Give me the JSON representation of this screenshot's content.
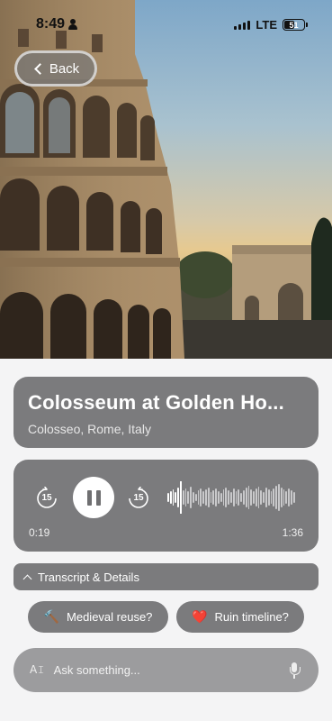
{
  "status_bar": {
    "time": "8:49",
    "network": "LTE",
    "battery": "51"
  },
  "nav": {
    "back_label": "Back"
  },
  "hero": {
    "image_icon": "colosseum-photo"
  },
  "title_card": {
    "title": "Colosseum at Golden Ho...",
    "subtitle": "Colosseo, Rome, Italy"
  },
  "player": {
    "skip_back_label": "15",
    "skip_forward_label": "15",
    "state": "playing",
    "elapsed": "0:19",
    "duration": "1:36",
    "progress": 0.198
  },
  "transcript": {
    "label": "Transcript & Details"
  },
  "suggestions": [
    {
      "emoji": "🔨",
      "label": "Medieval reuse?"
    },
    {
      "emoji": "❤️",
      "label": "Ruin timeline?"
    }
  ],
  "ask": {
    "placeholder": "Ask something...",
    "icon_text": "A𝙸"
  },
  "colors": {
    "card_bg": "#7b7b7d",
    "ask_bg": "#9c9c9e",
    "page_bg": "#f4f4f5"
  }
}
